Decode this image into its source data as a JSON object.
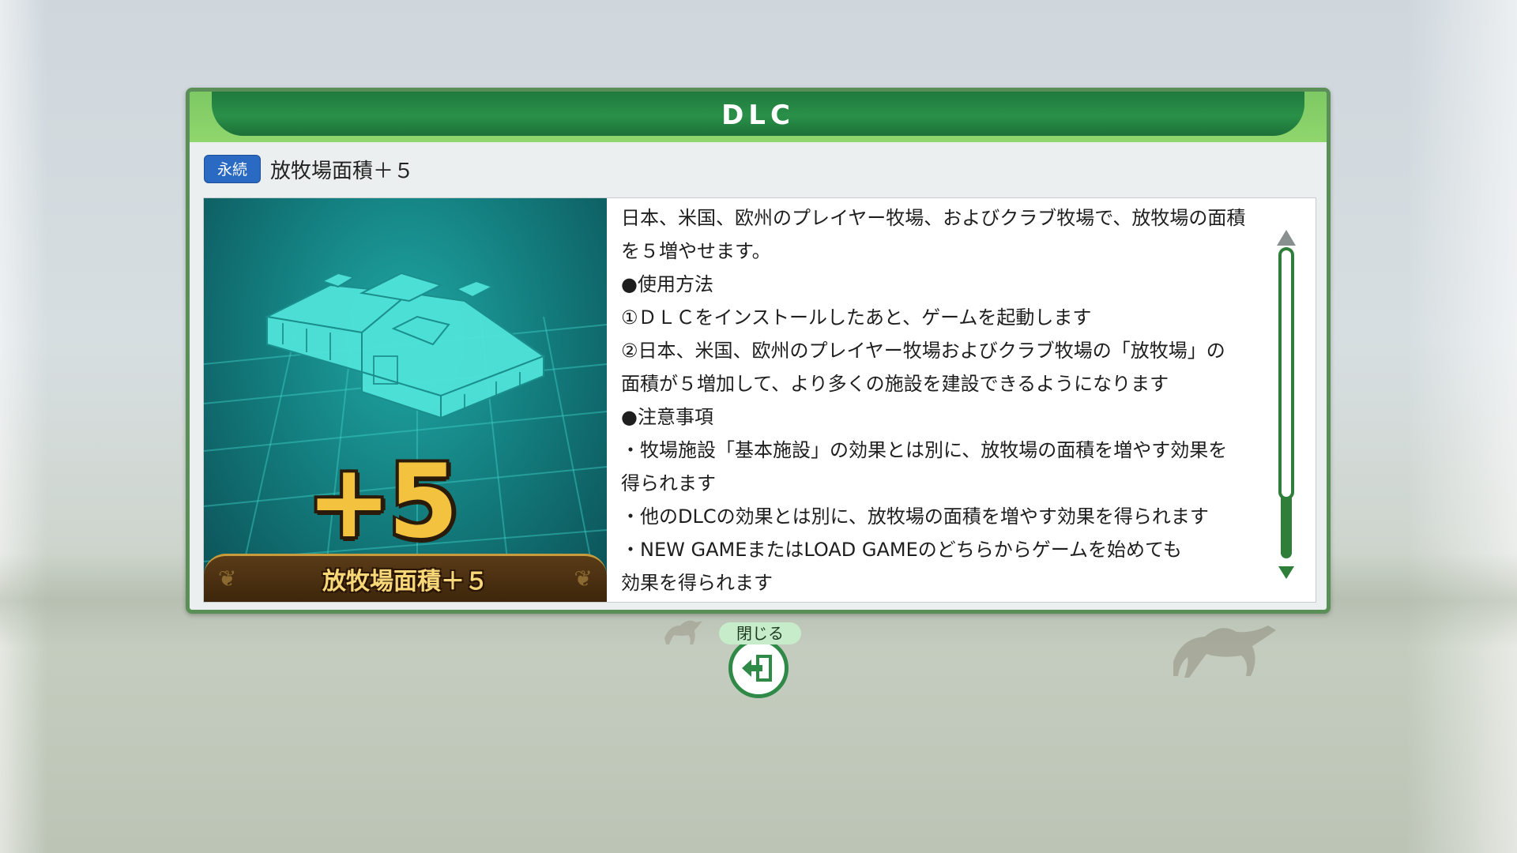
{
  "dialog": {
    "title": "DLC",
    "badge": "永続",
    "item_name": "放牧場面積＋５",
    "image": {
      "big_text": "+5",
      "banner_text": "放牧場面積＋５",
      "icon": "stable-building-icon"
    },
    "description": [
      "日本、米国、欧州のプレイヤー牧場、およびクラブ牧場で、放牧場の面積",
      "を５増やせます。",
      "●使用方法",
      "①ＤＬＣをインストールしたあと、ゲームを起動します",
      "②日本、米国、欧州のプレイヤー牧場およびクラブ牧場の「放牧場」の",
      "面積が５増加して、より多くの施設を建設できるようになります",
      "●注意事項",
      "・牧場施設「基本施設」の効果とは別に、放牧場の面積を増やす効果を",
      "得られます",
      "・他のDLCの効果とは別に、放牧場の面積を増やす効果を得られます",
      "・NEW GAMEまたはLOAD GAMEのどちらからゲームを始めても",
      "効果を得られます"
    ]
  },
  "close_button": {
    "label": "閉じる",
    "icon": "exit-door-icon"
  },
  "colors": {
    "header_green": "#2a9048",
    "header_light": "#8fd66d",
    "badge_blue": "#2a6ac2",
    "scroll_green": "#2f7e3a",
    "banner_gold": "#f7d778"
  }
}
